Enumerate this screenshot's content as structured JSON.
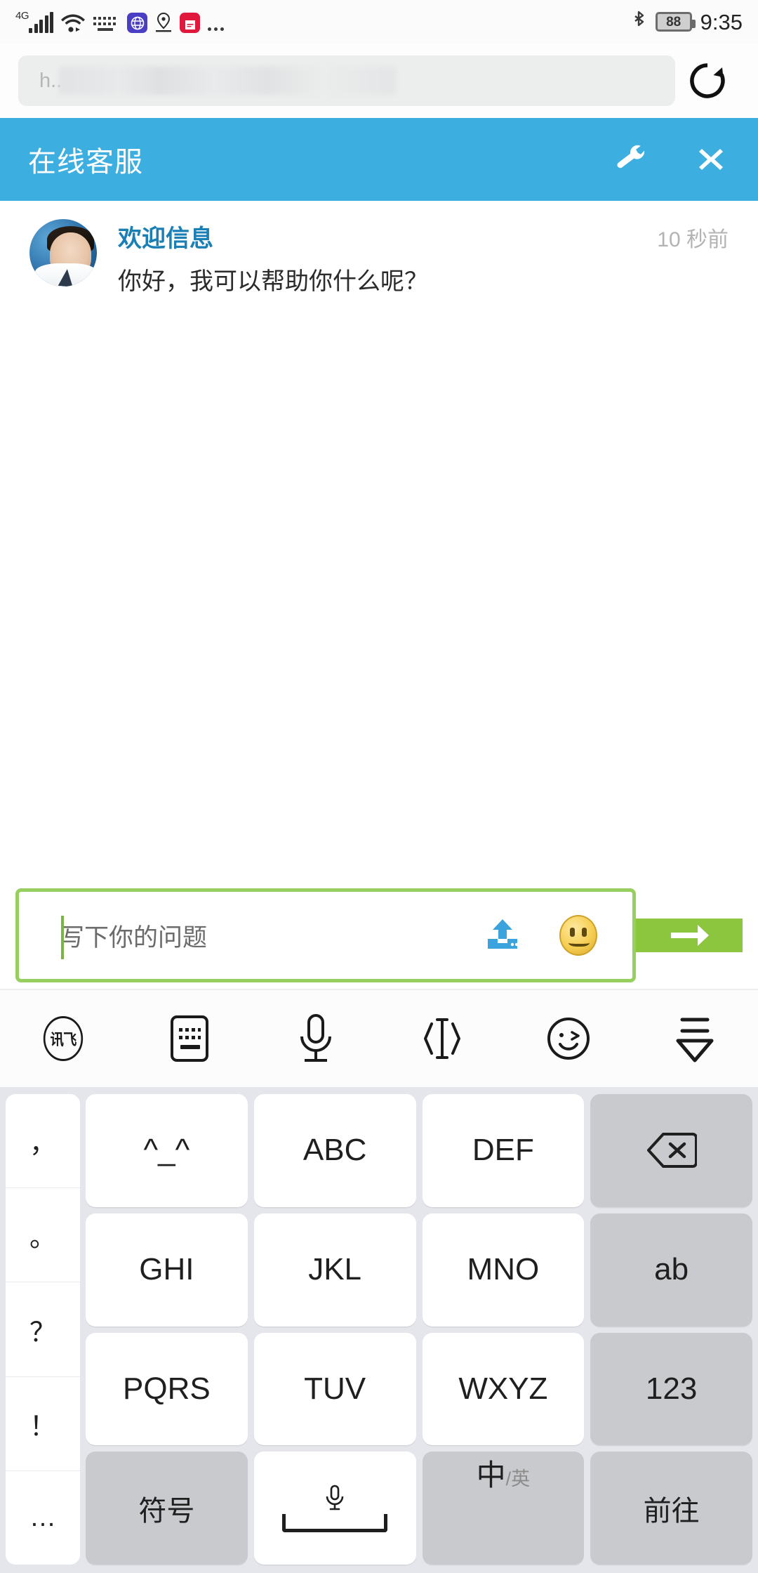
{
  "statusbar": {
    "network_label": "4G",
    "battery_level": "88",
    "time": "9:35",
    "icons": [
      "signal-bars-icon",
      "wifi-icon",
      "keyboard-icon",
      "app-purple-icon",
      "location-pin-icon",
      "app-shopping-bag-icon",
      "more-dots-icon",
      "bluetooth-icon",
      "battery-icon"
    ]
  },
  "browser": {
    "url_visible_text": "h....................o.php?widget-mobile",
    "reload_label": "reload-icon"
  },
  "chat_header": {
    "title": "在线客服",
    "settings_label": "wrench-icon",
    "close_label": "close-icon",
    "background_color": "#3caee0"
  },
  "message": {
    "sender": "欢迎信息",
    "time": "10 秒前",
    "text": "你好，我可以帮助你什么呢？",
    "sender_color": "#1a7fb5"
  },
  "input": {
    "placeholder": "写下你的问题",
    "value": "",
    "upload_label": "upload-icon",
    "emoji_label": "emoji-icon",
    "send_label": "send-arrow-icon",
    "border_color": "#96cf5d",
    "send_color": "#8cc63f"
  },
  "ime_toolbar": {
    "items": [
      {
        "name": "iflytek-logo-icon",
        "label": "讯飞"
      },
      {
        "name": "keyboard-layout-icon",
        "label": ""
      },
      {
        "name": "microphone-icon",
        "label": ""
      },
      {
        "name": "text-cursor-icon",
        "label": ""
      },
      {
        "name": "emoji-smiley-icon",
        "label": ""
      },
      {
        "name": "collapse-keyboard-icon",
        "label": ""
      }
    ]
  },
  "keyboard": {
    "punctuation_column": [
      "，",
      "。",
      "？",
      "！",
      "…"
    ],
    "rows": [
      [
        {
          "label": "^_^",
          "type": "normal"
        },
        {
          "label": "ABC",
          "type": "normal"
        },
        {
          "label": "DEF",
          "type": "normal"
        },
        {
          "label": "",
          "type": "fn",
          "icon": "backspace-icon"
        }
      ],
      [
        {
          "label": "GHI",
          "type": "normal"
        },
        {
          "label": "JKL",
          "type": "normal"
        },
        {
          "label": "MNO",
          "type": "normal"
        },
        {
          "label": "ab",
          "type": "fn"
        }
      ],
      [
        {
          "label": "PQRS",
          "type": "normal"
        },
        {
          "label": "TUV",
          "type": "normal"
        },
        {
          "label": "WXYZ",
          "type": "normal"
        },
        {
          "label": "123",
          "type": "fn"
        }
      ]
    ],
    "bottom_row": {
      "symbols": "符号",
      "space": "",
      "lang_primary": "中",
      "lang_secondary": "/英",
      "enter": "前往"
    }
  }
}
